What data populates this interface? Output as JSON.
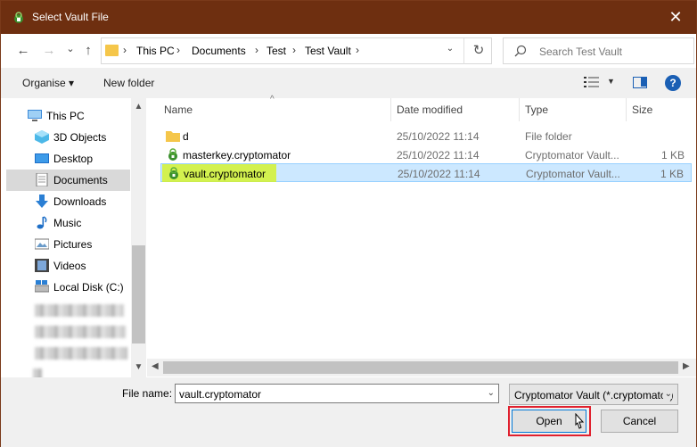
{
  "window": {
    "title": "Select Vault File",
    "close_glyph": "✕",
    "app_icon": "cryptomator-icon"
  },
  "nav": {
    "back": "←",
    "forward": "→",
    "recent": "⌄",
    "up": "↑",
    "breadcrumbs": [
      "This PC",
      "Documents",
      "Test",
      "Test Vault"
    ],
    "separator": "›",
    "dropdown": "⌄",
    "refresh": "↻",
    "search_placeholder": "Search Test Vault"
  },
  "toolbar": {
    "organise": "Organise ▾",
    "new_folder": "New folder",
    "help": "?"
  },
  "sidebar": {
    "items": [
      {
        "label": "This PC",
        "icon": "computer-icon"
      },
      {
        "label": "3D Objects",
        "icon": "3d-objects-icon"
      },
      {
        "label": "Desktop",
        "icon": "desktop-icon"
      },
      {
        "label": "Documents",
        "icon": "documents-icon",
        "selected": true
      },
      {
        "label": "Downloads",
        "icon": "downloads-icon"
      },
      {
        "label": "Music",
        "icon": "music-icon"
      },
      {
        "label": "Pictures",
        "icon": "pictures-icon"
      },
      {
        "label": "Videos",
        "icon": "videos-icon"
      },
      {
        "label": "Local Disk (C:)",
        "icon": "local-disk-icon"
      }
    ]
  },
  "file_list": {
    "columns": [
      "Name",
      "Date modified",
      "Type",
      "Size"
    ],
    "rows": [
      {
        "name": "d",
        "date": "25/10/2022 11:14",
        "type": "File folder",
        "size": "",
        "icon": "folder-icon"
      },
      {
        "name": "masterkey.cryptomator",
        "date": "25/10/2022 11:14",
        "type": "Cryptomator Vault...",
        "size": "1 KB",
        "icon": "cryptomator-file-icon"
      },
      {
        "name": "vault.cryptomator",
        "date": "25/10/2022 11:14",
        "type": "Cryptomator Vault...",
        "size": "1 KB",
        "icon": "cryptomator-file-icon",
        "selected": true
      }
    ]
  },
  "bottom": {
    "file_name_label": "File name:",
    "file_name_value": "vault.cryptomator",
    "filter_value": "Cryptomator Vault (*.cryptomator)",
    "open_label": "Open",
    "cancel_label": "Cancel"
  },
  "colors": {
    "titlebar": "#6e2f10",
    "selection": "#cce8ff",
    "highlight": "#d4f230",
    "annotation_box": "#e0202e"
  }
}
